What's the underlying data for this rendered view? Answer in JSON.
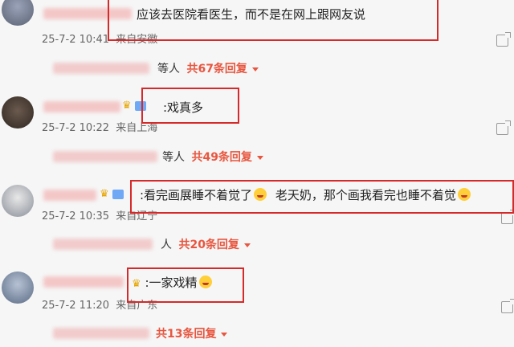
{
  "comments": [
    {
      "text": "应该去医院看医生，而不是在网上跟网友说",
      "date": "25-7-2 10:41",
      "location": "来自安徽",
      "reply_suffix": "等人",
      "reply_count": "共67条回复"
    },
    {
      "text": ":戏真多",
      "date": "25-7-2 10:22",
      "location": "来自上海",
      "reply_suffix": "等人",
      "reply_count": "共49条回复"
    },
    {
      "text": ":看完画展睡不着觉了",
      "text2": "老天奶，那个画我看完也睡不着觉",
      "date": "25-7-2 10:35",
      "location": "来自辽宁",
      "reply_suffix": "人",
      "reply_count": "共20条回复"
    },
    {
      "text": ":一家戏精",
      "date": "25-7-2 11:20",
      "location": "来自广东",
      "reply_count": "共13条回复"
    }
  ],
  "colors": {
    "accent": "#e8563f",
    "highlight_box": "#d62a2a"
  }
}
